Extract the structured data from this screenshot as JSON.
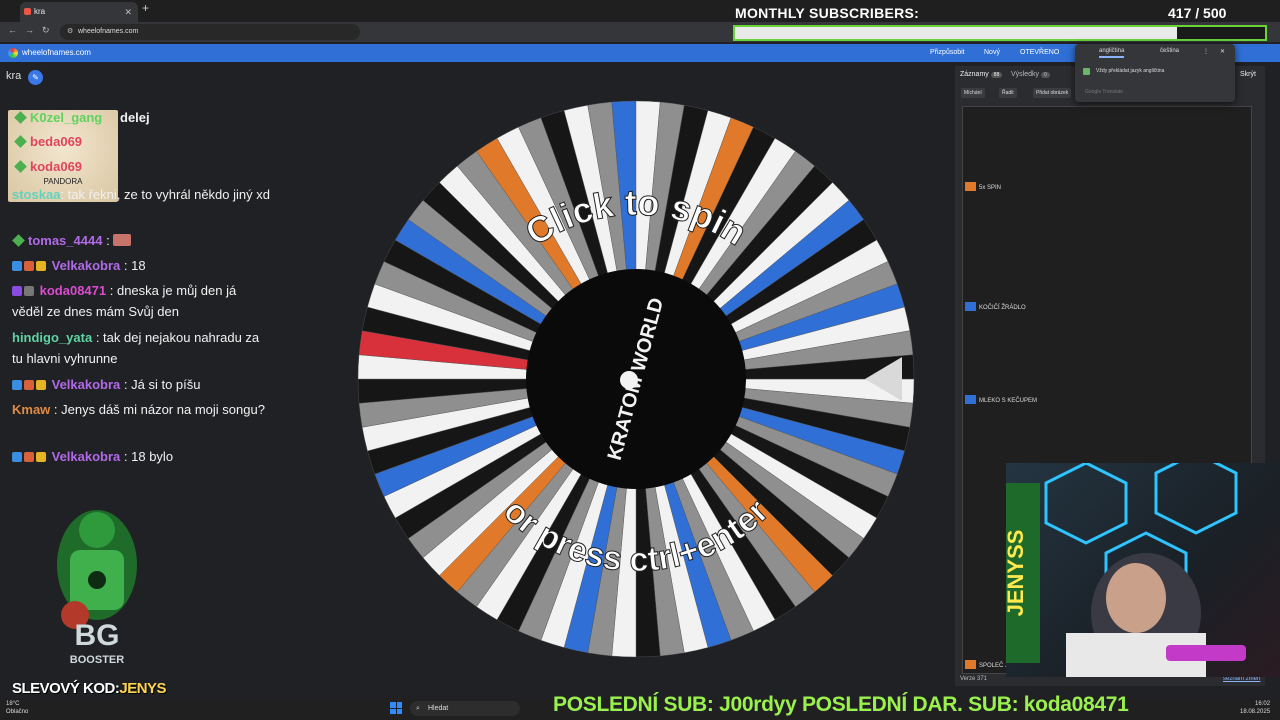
{
  "browser": {
    "tab_title": "kra",
    "url": "wheelofnames.com"
  },
  "site": {
    "brand": "wheelofnames.com",
    "buttons": [
      "Přizpůsobit",
      "Nový",
      "OTEVŘENO"
    ]
  },
  "page": {
    "title": "kra"
  },
  "chat": {
    "badge_caption": "PANDORA",
    "top_names": [
      "K0zel_gang",
      "beda069",
      "koda069"
    ],
    "top_name_colors": [
      "#5fd35f",
      "#e0445e",
      "#e0445e"
    ],
    "top_text": "delej",
    "messages": [
      {
        "user": "stoskaa",
        "color": "#5fd3c2",
        "text": ": tak řekni, ze to vyhrál někdo jiný xd"
      },
      {
        "user": "tomas_4444",
        "color": "#b06ae8",
        "text": ":"
      },
      {
        "user": "Velkakobra",
        "color": "#b06ae8",
        "text": ": 18"
      },
      {
        "user": "koda08471",
        "color": "#d94ccf",
        "text": ": dneska je můj den já věděl ze dnes mám Svůj den"
      },
      {
        "user": "hindigo_yata",
        "color": "#5fd3a2",
        "text": ": tak dej nejakou nahradu za tu hlavni vyhrunne"
      },
      {
        "user": "Velkakobra",
        "color": "#b06ae8",
        "text": ": Já si to píšu"
      },
      {
        "user": "Kmaw",
        "color": "#e08a44",
        "text": ": Jenys dáš mi názor na moji songu?"
      },
      {
        "user": "Velkakobra",
        "color": "#b06ae8",
        "text": ": 18 bylo"
      }
    ]
  },
  "promo": {
    "label": "SLEVOVÝ KOD:",
    "code": "JENYS",
    "logo_text": "BOOSTER"
  },
  "wheel": {
    "center_text": "KRATOM WORLD",
    "prompt_top": "Click to spin",
    "prompt_bottom": "or press ctrl+enter",
    "segments": 72,
    "colors": {
      "white": "#f2f2f2",
      "gray": "#8f8f8f",
      "black": "#161616",
      "blue": "#2f6fd6",
      "orange": "#e07a2a",
      "red": "#d8313c"
    }
  },
  "subscribers": {
    "title": "MONTHLY SUBSCRIBERS:",
    "count": "417 / 500",
    "progress": 0.834
  },
  "panel": {
    "tab_entries": "Záznamy",
    "tab_entries_count": "88",
    "tab_results": "Výsledky",
    "tab_results_count": "0",
    "tools": [
      "Míchání",
      "Řadit",
      "Přidat obrázek"
    ],
    "entries": [
      {
        "label": "5x SPIN",
        "color": "#e07a2a"
      },
      {
        "label": "KOČIČÍ ŽRÁDLO",
        "color": "#2f6fd6"
      },
      {
        "label": "MLEKO S KEČUPEM",
        "color": "#2f6fd6"
      },
      {
        "label": "SPOLEČ J",
        "color": "#e07a2a"
      }
    ],
    "version": "Verze 371",
    "changes_link": "seznam změn",
    "hide_label": "Skrýt"
  },
  "translate": {
    "lang_from": "angličtina",
    "lang_to": "čeština",
    "always_label": "Vždy překládat jazyk angličtina",
    "brand": "Google Translate"
  },
  "ticker": {
    "text": "POSLEDNÍ SUB: J00rdyy  POSLEDNÍ DAR. SUB: koda08471"
  },
  "taskbar": {
    "weather_temp": "18°C",
    "weather_desc": "Oblačno",
    "search_placeholder": "Hledat",
    "time": "16:02",
    "date": "18.08.2025"
  },
  "webcam": {
    "name": "JENYSS"
  }
}
